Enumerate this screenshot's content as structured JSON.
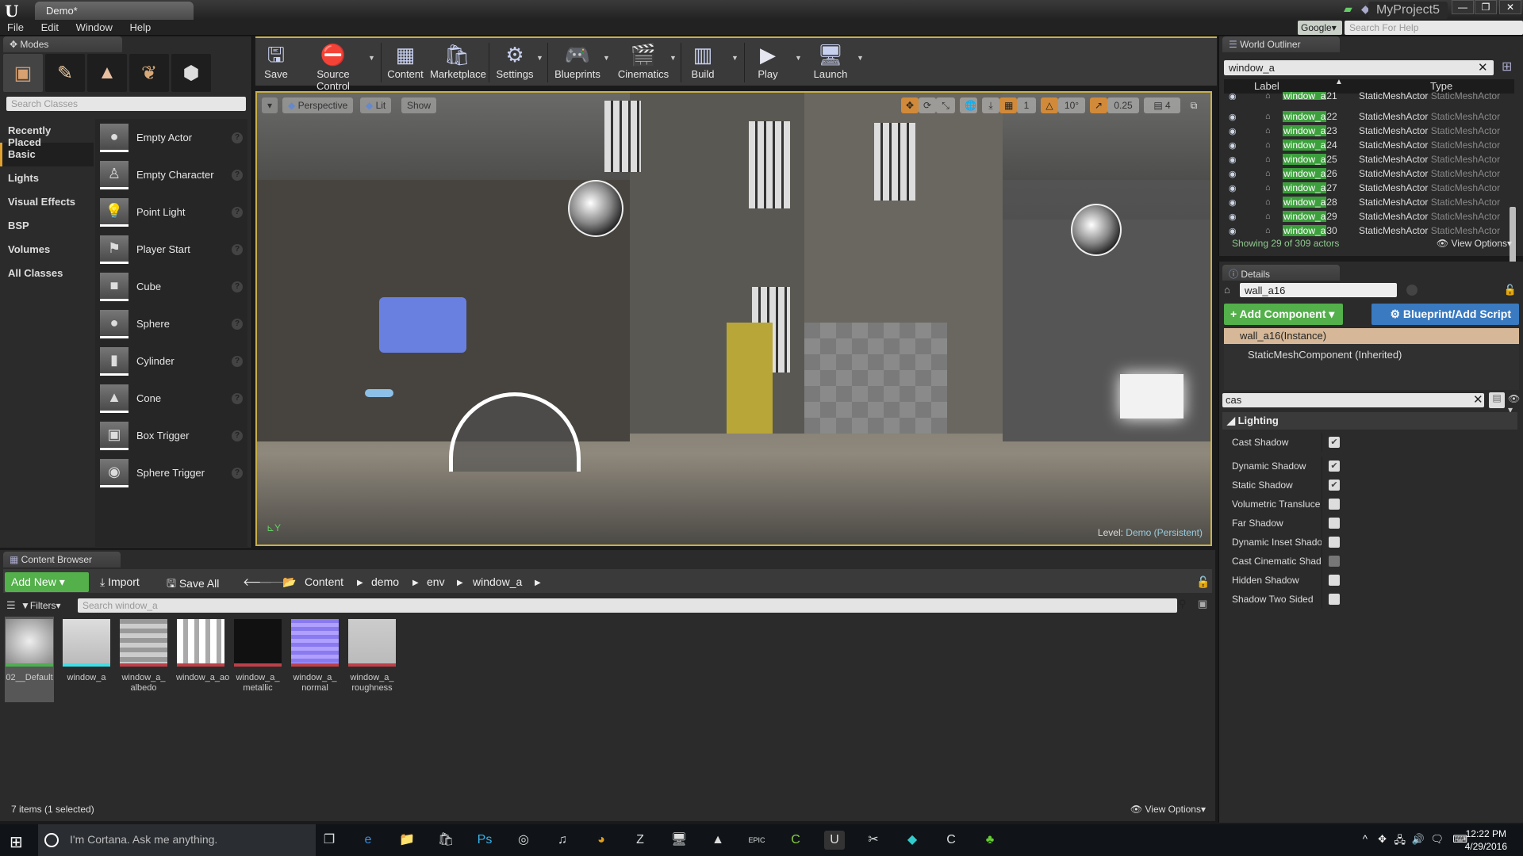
{
  "window": {
    "app_logo": "U",
    "doc_tab": "Demo*",
    "project": "MyProject5",
    "minimize": "—",
    "maximize": "❐",
    "close": "✕"
  },
  "menu": [
    "File",
    "Edit",
    "Window",
    "Help"
  ],
  "help_search": {
    "engine": "Google▾",
    "placeholder": "Search For Help"
  },
  "modes": {
    "tab": "Modes",
    "mode_icons": [
      "place-mode-icon",
      "paint-mode-icon",
      "landscape-mode-icon",
      "foliage-mode-icon",
      "geometry-mode-icon"
    ],
    "search_placeholder": "Search Classes",
    "categories": [
      "Recently Placed",
      "Basic",
      "Lights",
      "Visual Effects",
      "BSP",
      "Volumes",
      "All Classes"
    ],
    "active_category": "Basic",
    "classes": [
      "Empty Actor",
      "Empty Character",
      "Point Light",
      "Player Start",
      "Cube",
      "Sphere",
      "Cylinder",
      "Cone",
      "Box Trigger",
      "Sphere Trigger"
    ]
  },
  "toolbar": {
    "buttons": [
      "Save",
      "Source Control",
      "Content",
      "Marketplace",
      "Settings",
      "Blueprints",
      "Cinematics",
      "Build",
      "Play",
      "Launch"
    ]
  },
  "viewport": {
    "view_mode": "Perspective",
    "lighting": "Lit",
    "show": "Show",
    "grid_snap": "1",
    "rotation_snap": "10°",
    "scale_snap": "0.25",
    "camera_speed": "4",
    "level_label": "Level:",
    "level_name": "Demo (Persistent)"
  },
  "outliner": {
    "tab": "World Outliner",
    "filter": "window_a",
    "col_label": "Label",
    "col_type": "Type",
    "rows": [
      {
        "match": "window_a",
        "suffix": "21",
        "type": "StaticMeshActor",
        "type2": "StaticMeshActor"
      },
      {
        "match": "window_a",
        "suffix": "22",
        "type": "StaticMeshActor",
        "type2": "StaticMeshActor"
      },
      {
        "match": "window_a",
        "suffix": "23",
        "type": "StaticMeshActor",
        "type2": "StaticMeshActor"
      },
      {
        "match": "window_a",
        "suffix": "24",
        "type": "StaticMeshActor",
        "type2": "StaticMeshActor"
      },
      {
        "match": "window_a",
        "suffix": "25",
        "type": "StaticMeshActor",
        "type2": "StaticMeshActor"
      },
      {
        "match": "window_a",
        "suffix": "26",
        "type": "StaticMeshActor",
        "type2": "StaticMeshActor"
      },
      {
        "match": "window_a",
        "suffix": "27",
        "type": "StaticMeshActor",
        "type2": "StaticMeshActor"
      },
      {
        "match": "window_a",
        "suffix": "28",
        "type": "StaticMeshActor",
        "type2": "StaticMeshActor"
      },
      {
        "match": "window_a",
        "suffix": "29",
        "type": "StaticMeshActor",
        "type2": "StaticMeshActor"
      },
      {
        "match": "window_a",
        "suffix": "30",
        "type": "StaticMeshActor",
        "type2": "StaticMeshActor"
      }
    ],
    "status": "Showing 29 of 309 actors",
    "view_options": "View Options▾"
  },
  "details": {
    "tab": "Details",
    "actor_name": "wall_a16",
    "add_component": "+ Add Component ▾",
    "blueprint_script": "⚙ Blueprint/Add Script",
    "component_instance": "wall_a16(Instance)",
    "component_inherited": "StaticMeshComponent (Inherited)",
    "property_search": "cas",
    "section": "Lighting",
    "properties": [
      {
        "label": "Cast Shadow",
        "checked": true
      },
      {
        "label": "Dynamic Shadow",
        "checked": true
      },
      {
        "label": "Static Shadow",
        "checked": true
      },
      {
        "label": "Volumetric Transluce",
        "checked": false
      },
      {
        "label": "Far Shadow",
        "checked": false
      },
      {
        "label": "Dynamic Inset Shado",
        "checked": false
      },
      {
        "label": "Cast Cinematic Shado",
        "checked": false,
        "disabled": true
      },
      {
        "label": "Hidden Shadow",
        "checked": false
      },
      {
        "label": "Shadow Two Sided",
        "checked": false
      }
    ]
  },
  "content_browser": {
    "tab": "Content Browser",
    "add_new": "Add New ▾",
    "import": "⤓ Import",
    "save_all": "🖫 Save All",
    "path": [
      "Content",
      "demo",
      "env",
      "window_a"
    ],
    "filters": "▼Filters▾",
    "search_placeholder": "Search window_a",
    "assets": [
      {
        "name": "02__Default",
        "color": "#4caf50",
        "selected": true
      },
      {
        "name": "window_a",
        "color": "#3fe0e8"
      },
      {
        "name": "window_a_ albedo",
        "color": "#c04048"
      },
      {
        "name": "window_a_ao",
        "color": "#c04048"
      },
      {
        "name": "window_a_ metallic",
        "color": "#c04048"
      },
      {
        "name": "window_a_ normal",
        "color": "#c04048"
      },
      {
        "name": "window_a_ roughness",
        "color": "#c04048"
      }
    ],
    "status": "7 items (1 selected)",
    "view_options": "View Options▾"
  },
  "taskbar": {
    "cortana": "I'm Cortana. Ask me anything.",
    "apps": [
      "task-view-icon",
      "edge-icon",
      "file-explorer-icon",
      "store-icon",
      "photoshop-icon",
      "app-icon",
      "itunes-icon",
      "chrome-icon",
      "zbrush-icon",
      "network-icon",
      "photos-icon",
      "epic-launcher-icon",
      "camtasia-icon",
      "unreal-icon",
      "snipping-icon",
      "app2-icon",
      "camtasia2-icon",
      "app3-icon"
    ],
    "time": "12:22 PM",
    "date": "4/29/2016"
  }
}
